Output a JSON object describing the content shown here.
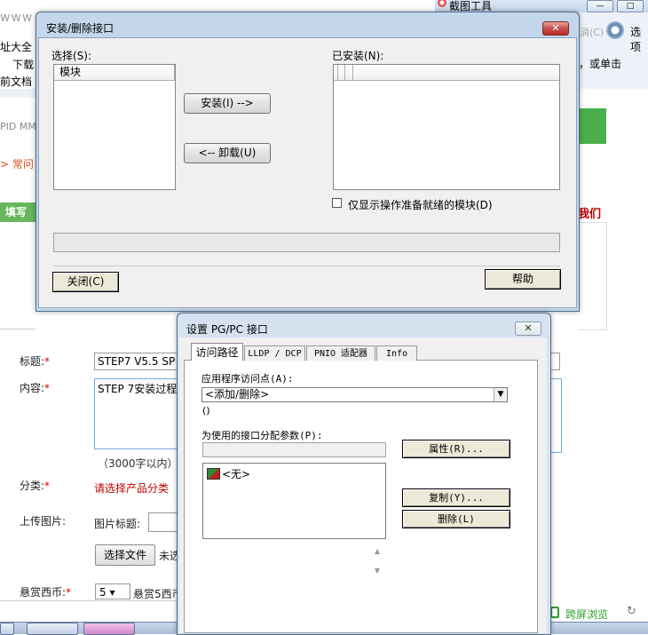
{
  "background": {
    "url_fragment": "www",
    "nav": {
      "item1": "址大全",
      "item2": "下载",
      "item3": "前文档"
    },
    "pid_text": "PID  MM",
    "often_text": "> 常问",
    "green_tab": "填写问",
    "red_link": "我们",
    "form": {
      "title_label": "标题:",
      "title_value": "STEP7 V5.5 SP",
      "content_label": "内容:",
      "content_value": "STEP 7安装过程",
      "char_limit": "（3000字以内）",
      "category_label": "分类:",
      "category_value": "请选择产品分类",
      "upload_label": "上传图片:",
      "image_title_label": "图片标题:",
      "choose_file_button": "选择文件",
      "file_status": "未选",
      "reward_label": "悬赏西币:",
      "reward_value": "5",
      "reward_hint": "悬赏5西币"
    },
    "required_mark": "*",
    "cross_screen": "跨屏浏览"
  },
  "capture_tool": {
    "title": "截图工具",
    "toolbar_text": "消(C)",
    "options_label": "选项",
    "hint": "，或单击",
    "min_glyph": "—",
    "max_glyph": "□"
  },
  "install_dialog": {
    "title": "安装/删除接口",
    "close_glyph": "✕",
    "select_label": "选择(S):",
    "installed_label": "已安装(N):",
    "select_list_header": "模块",
    "install_button": "安装(I) -->",
    "uninstall_button": "<-- 卸载(U)",
    "ready_only_label": "仅显示操作准备就绪的模块(D)",
    "ready_only_checked": false,
    "close_button": "关闭(C)",
    "help_button": "帮助"
  },
  "pgpc_dialog": {
    "title": "设置 PG/PC 接口",
    "close_glyph": "✕",
    "tabs": [
      "访问路径",
      "LLDP / DCP",
      "PNIO 适配器",
      "Info"
    ],
    "active_tab": "访问路径",
    "access_point_label": "应用程序访问点(A):",
    "access_point_value": "<添加/删除>",
    "access_point_extra": "()",
    "param_label": "为使用的接口分配参数(P):",
    "properties_button": "属性(R)...",
    "copy_button": "复制(Y)...",
    "delete_button": "删除(L)",
    "interface_list": [
      {
        "label": "<无>",
        "icon": "network-none-icon"
      }
    ]
  }
}
